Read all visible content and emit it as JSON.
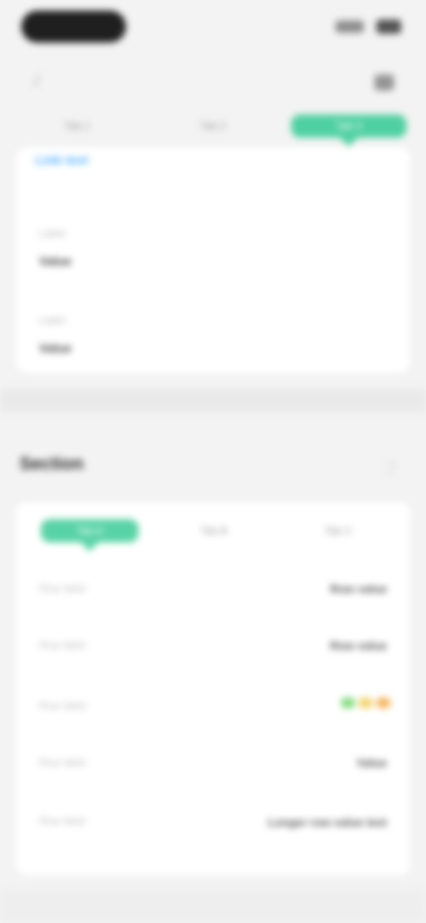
{
  "top_tabs": [
    {
      "label": "Tab 1"
    },
    {
      "label": "Tab 2"
    },
    {
      "label": "Tab 3"
    }
  ],
  "top_card": {
    "link_text": "Link text",
    "field1_label": "Label",
    "field1_value": "Value",
    "field2_label": "Label",
    "field2_value": "Value"
  },
  "section": {
    "title": "Section",
    "tabs": [
      {
        "label": "Tab A"
      },
      {
        "label": "Tab B"
      },
      {
        "label": "Tab C"
      }
    ],
    "rows": [
      {
        "label": "Row label",
        "value": "Row value"
      },
      {
        "label": "Row label",
        "value": "Row value"
      },
      {
        "label": "Row label",
        "value": ""
      },
      {
        "label": "Row label",
        "value": "Value"
      },
      {
        "label": "Row label",
        "value": "Longer row value text"
      }
    ]
  },
  "colors": {
    "accent_green": "#4fd0a2",
    "link_blue": "#43a9ff",
    "dot_green": "#7fdc7a",
    "dot_yellow": "#f2d46b",
    "dot_orange": "#f6b35a"
  },
  "icons": {
    "back": "chevron-left-icon",
    "action": "menu-icon",
    "expand": "chevron-right-icon",
    "signal": "signal-icon",
    "battery": "battery-icon"
  }
}
